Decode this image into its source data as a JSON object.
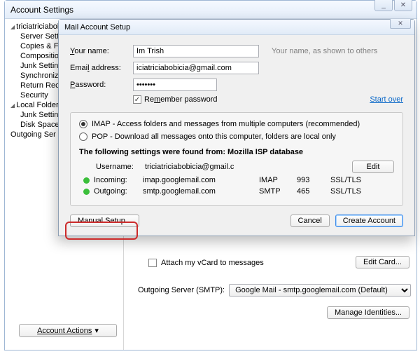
{
  "accountSettings": {
    "title": "Account Settings",
    "tree": {
      "account": "triciatriciabobi",
      "children": [
        "Server Settin",
        "Copies & Fo",
        "Compositio",
        "Junk Settin",
        "Synchroniz",
        "Return Rece",
        "Security"
      ],
      "local": "Local Folders",
      "localChildren": [
        "Junk Settin",
        "Disk Space"
      ],
      "outgoing": "Outgoing Ser"
    },
    "accountActions": "Account Actions",
    "right": {
      "attachVcard": "Attach my vCard to messages",
      "editCard": "Edit Card...",
      "smtpLbl": "Outgoing Server (SMTP):",
      "smtpValue": "Google Mail - smtp.googlemail.com (Default)",
      "manageIdentities": "Manage Identities..."
    }
  },
  "dialog": {
    "title": "Mail Account Setup",
    "yourNameLbl": "Your name:",
    "yourName": "Im Trish",
    "yourNameHint": "Your name, as shown to others",
    "emailLbl": "Email address:",
    "email": "iciatriciabobicia@gmail.com",
    "passwordLbl": "Password:",
    "password": "•••••••",
    "remember": "Remember password",
    "startOver": "Start over",
    "imap": "IMAP - Access folders and messages from multiple computers   (recommended)",
    "pop": "POP - Download all messages onto this computer, folders are local only",
    "found": "The following settings were found from: Mozilla ISP database",
    "usernameLbl": "Username:",
    "username": "triciatriciabobicia@gmail.c",
    "edit": "Edit",
    "incomingLbl": "Incoming:",
    "incomingHost": "imap.googlemail.com",
    "incomingProto": "IMAP",
    "incomingPort": "993",
    "incomingSec": "SSL/TLS",
    "outgoingLbl": "Outgoing:",
    "outgoingHost": "smtp.googlemail.com",
    "outgoingProto": "SMTP",
    "outgoingPort": "465",
    "outgoingSec": "SSL/TLS",
    "manualSetup": "Manual Setup...",
    "cancel": "Cancel",
    "create": "Create Account"
  }
}
